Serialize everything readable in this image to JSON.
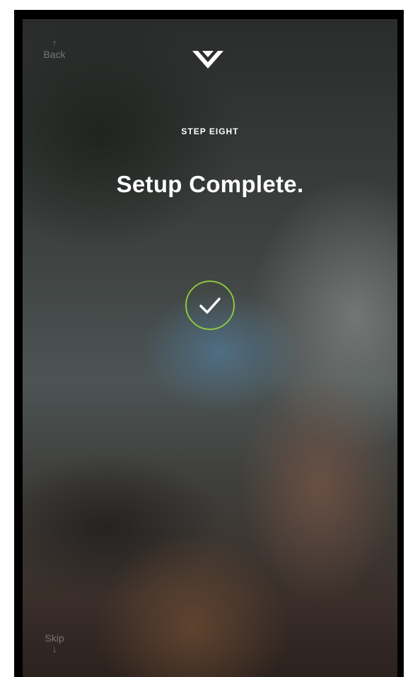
{
  "nav": {
    "back_label": "Back",
    "back_arrow": "↑",
    "skip_label": "Skip",
    "skip_arrow": "↓"
  },
  "header": {
    "logo_icon": "vizio-v-logo-icon"
  },
  "content": {
    "step_label": "STEP EIGHT",
    "title": "Setup Complete.",
    "status_icon": "checkmark-circle-icon",
    "accent_color": "#8dc63f"
  }
}
